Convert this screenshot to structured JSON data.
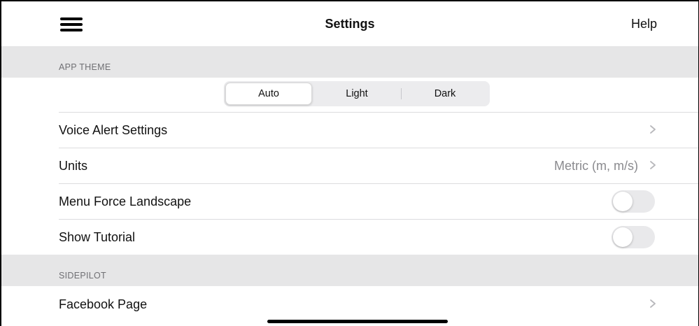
{
  "nav": {
    "title": "Settings",
    "help_label": "Help",
    "menu_icon": "hamburger-menu-icon"
  },
  "sections": {
    "app_theme": "APP THEME",
    "sidepilot": "SIDEPILOT"
  },
  "theme": {
    "options": [
      "Auto",
      "Light",
      "Dark"
    ],
    "selected": "Auto"
  },
  "rows": {
    "voice_alert": {
      "label": "Voice Alert Settings"
    },
    "units": {
      "label": "Units",
      "value": "Metric (m, m/s)"
    },
    "menu_force_landscape": {
      "label": "Menu Force Landscape",
      "toggle_on": false
    },
    "show_tutorial": {
      "label": "Show Tutorial",
      "toggle_on": false
    },
    "facebook_page": {
      "label": "Facebook Page"
    }
  },
  "icons": {
    "chevron": "chevron-right-icon"
  },
  "colors": {
    "section_bg": "#e6e6e7",
    "secondary_text": "#8a8a8e",
    "toggle_off": "#e9e9eb"
  }
}
